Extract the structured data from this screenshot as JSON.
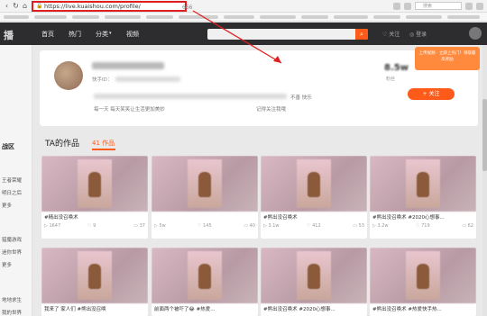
{
  "browser": {
    "url": "https://live.kuaishou.com/profile/",
    "url_tail": "666",
    "search_placeholder": "搜索"
  },
  "header": {
    "logo": "播",
    "nav": [
      "首页",
      "热门",
      "分类",
      "视频"
    ],
    "follow_label": "关注",
    "login_label": "登录"
  },
  "sidebar": {
    "items": [
      "战区",
      "王者荣耀",
      "明日之后",
      "更多",
      "猎魔游戏",
      "迷你世界",
      "更多",
      "地地求生",
      "我的世界"
    ]
  },
  "profile": {
    "kuaishou_id_label": "快手ID：",
    "bio_line1_end": "不善  快乐",
    "bio_line2_start": "每一天  每天笑笑让生活更加美妙",
    "bio_line2_end": "记得关注我哦",
    "fans_count": "8.5w",
    "fans_label": "粉丝",
    "follow_button": "+ 关注",
    "promo_text": "上传视频 · 立即上热门！领取最高奖励"
  },
  "works": {
    "title": "TA的作品",
    "count": "41 作品",
    "videos": [
      {
        "title": "#精出没召唤术",
        "views": "1647",
        "likes": "9",
        "comments": "37"
      },
      {
        "title": "",
        "views": "5w",
        "likes": "145",
        "comments": "40"
      },
      {
        "title": "#熊出没召唤术",
        "views": "3.1w",
        "likes": "412",
        "comments": "53"
      },
      {
        "title": "#熊出没召唤术 #2020心想事...",
        "views": "3.2w",
        "likes": "719",
        "comments": "62"
      },
      {
        "title": "我来了  家人们 #熊出没召唤",
        "views": "",
        "likes": "",
        "comments": ""
      },
      {
        "title": "前面两个被吓了😂 #热爱...",
        "views": "",
        "likes": "",
        "comments": ""
      },
      {
        "title": "#熊出没召唤术 #2020心想事...",
        "views": "",
        "likes": "",
        "comments": ""
      },
      {
        "title": "#熊出没召唤术 #热爱快手热...",
        "views": "",
        "likes": "",
        "comments": ""
      }
    ]
  },
  "colors": {
    "accent": "#fe5b1b",
    "header_bg": "#2d2d30",
    "highlight_border": "#e02020"
  }
}
